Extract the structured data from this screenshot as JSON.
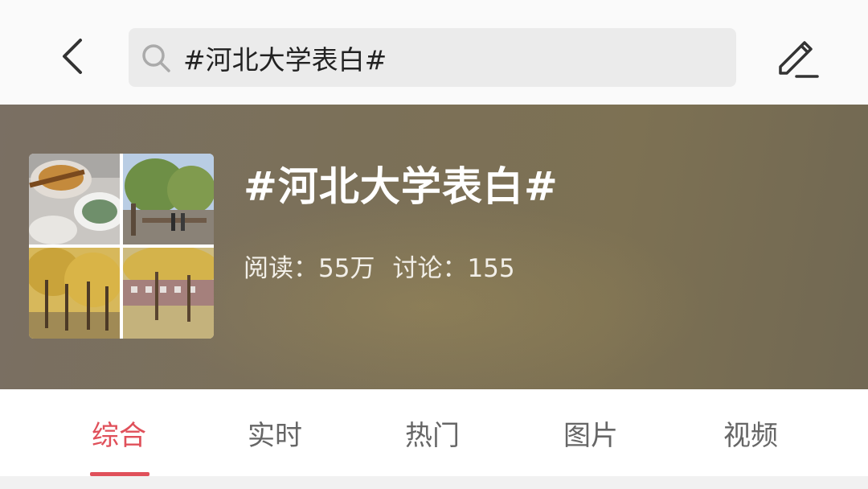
{
  "header": {
    "back_icon": "chevron-left-icon",
    "search": {
      "icon": "search-icon",
      "value": "#河北大学表白#"
    },
    "edit_icon": "pencil-icon"
  },
  "topic": {
    "title": "#河北大学表白#",
    "reads_label": "阅读：",
    "reads_value": "55万",
    "discussions_label": "讨论：",
    "discussions_value": "155",
    "thumbnails": [
      "food-photo",
      "willow-trees-photo",
      "ginkgo-trees-photo",
      "campus-building-photo"
    ]
  },
  "tabs": [
    {
      "label": "综合",
      "active": true
    },
    {
      "label": "实时",
      "active": false
    },
    {
      "label": "热门",
      "active": false
    },
    {
      "label": "图片",
      "active": false
    },
    {
      "label": "视频",
      "active": false
    }
  ],
  "colors": {
    "accent": "#e0505a",
    "hero_bg": "#7b7058",
    "search_bg": "#ebebeb"
  }
}
